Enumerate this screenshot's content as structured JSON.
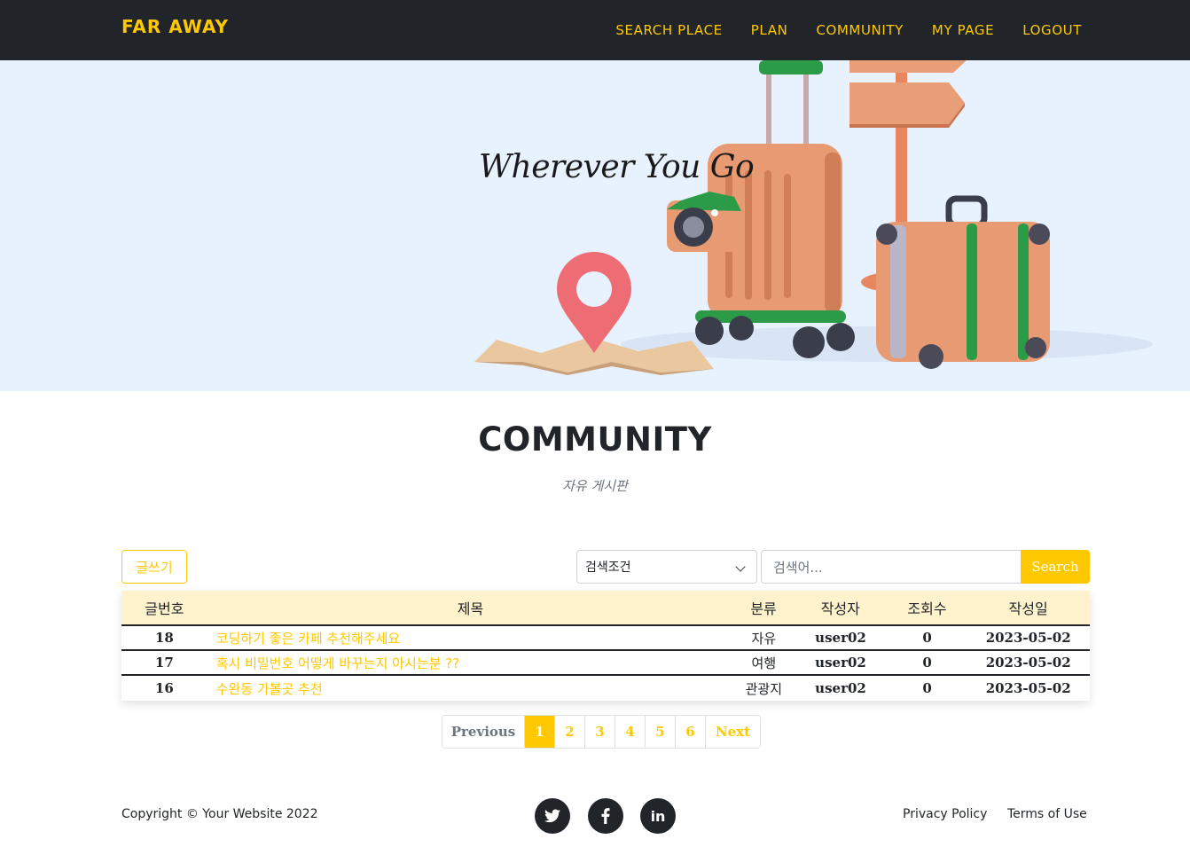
{
  "nav": {
    "brand": "FAR AWAY",
    "links": [
      "SEARCH PLACE",
      "PLAN",
      "COMMUNITY",
      "MY PAGE",
      "LOGOUT"
    ]
  },
  "hero": {
    "tagline": "Wherever You Go"
  },
  "section": {
    "title": "COMMUNITY",
    "subtitle": "자유 게시판"
  },
  "toolbar": {
    "write_label": "글쓰기",
    "select_value": "검색조건",
    "search_placeholder": "검색어...",
    "search_label": "Search"
  },
  "table": {
    "headers": [
      "글번호",
      "제목",
      "분류",
      "작성자",
      "조회수",
      "작성일"
    ],
    "rows": [
      {
        "no": "18",
        "title": "코딩하기 좋은 카페 추천해주세요",
        "category": "자유",
        "author": "user02",
        "views": "0",
        "date": "2023-05-02"
      },
      {
        "no": "17",
        "title": "혹시 비밀번호 어떻게 바꾸는지 아시는분 ??",
        "category": "여행",
        "author": "user02",
        "views": "0",
        "date": "2023-05-02"
      },
      {
        "no": "16",
        "title": "수완동 가볼곳 추천",
        "category": "관광지",
        "author": "user02",
        "views": "0",
        "date": "2023-05-02"
      }
    ]
  },
  "pagination": {
    "previous": "Previous",
    "pages": [
      "1",
      "2",
      "3",
      "4",
      "5",
      "6"
    ],
    "active_page": "1",
    "next": "Next"
  },
  "footer": {
    "copyright": "Copyright © Your Website 2022",
    "social": [
      {
        "icon": "twitter-icon"
      },
      {
        "icon": "facebook-icon"
      },
      {
        "icon": "linkedin-icon"
      }
    ],
    "privacy": "Privacy Policy",
    "terms": "Terms of Use"
  },
  "colors": {
    "accent": "#ffc800",
    "navbar": "#212529",
    "hero_bg": "#e8f2fe",
    "table_header_bg": "#fff3cd"
  }
}
